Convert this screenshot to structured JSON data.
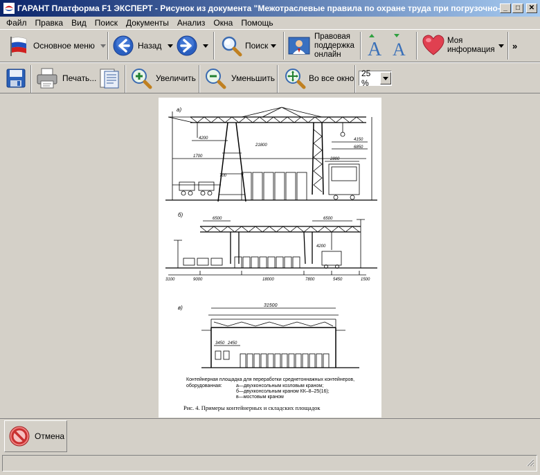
{
  "window": {
    "title": "ГАРАНТ Платформа F1 ЭКСПЕРТ - Рисунок из документа \"Межотраслевые правила по охране труда при погрузочно-...",
    "minimize_glyph": "_",
    "maximize_glyph": "□",
    "close_glyph": "✕"
  },
  "menu": [
    "Файл",
    "Правка",
    "Вид",
    "Поиск",
    "Документы",
    "Анализ",
    "Окна",
    "Помощь"
  ],
  "toolbar1": {
    "main_menu_label": "Основное меню",
    "back_label": "Назад",
    "search_label": "Поиск",
    "legal_support_lines": [
      "Правовая",
      "поддержка",
      "онлайн"
    ],
    "my_info_lines": [
      "Моя",
      "информация"
    ],
    "more_glyph": "»"
  },
  "toolbar2": {
    "print_label": "Печать...",
    "zoom_in_label": "Увеличить",
    "zoom_out_label": "Уменьшить",
    "fit_window_label": "Во все окно",
    "zoom_value": "25 %"
  },
  "figure": {
    "panel_a_label": "а)",
    "panel_b_label": "б)",
    "panel_c_label": "в)",
    "dims_a": [
      "4200",
      "21800",
      "1700",
      "700",
      "4150",
      "6850",
      "2800"
    ],
    "dims_b": [
      "6500",
      "6500",
      "4200",
      "9000",
      "18000",
      "7800",
      "5450",
      "1500",
      "3100"
    ],
    "dims_c": [
      "31500",
      "3450",
      "2450"
    ],
    "caption_lines": [
      "Контейнерная площадка для переработки среднетоннажных контейнеров,",
      "оборудованная:",
      "а—двухконсольным козловым краном;",
      "б—двухконсольным краном КК–8–25(16);",
      "в—мостовым краном"
    ],
    "figure_title": "Рис. 4. Примеры контейнерных и складских площадок"
  },
  "bottom": {
    "cancel_label": "Отмена"
  },
  "colors": {
    "titlebar_start": "#0a246a",
    "titlebar_end": "#a6caf0",
    "chrome": "#d4d0c8",
    "nav_blue": "#2a5fc0",
    "heart_red": "#e04050",
    "cancel_red": "#c83030"
  }
}
